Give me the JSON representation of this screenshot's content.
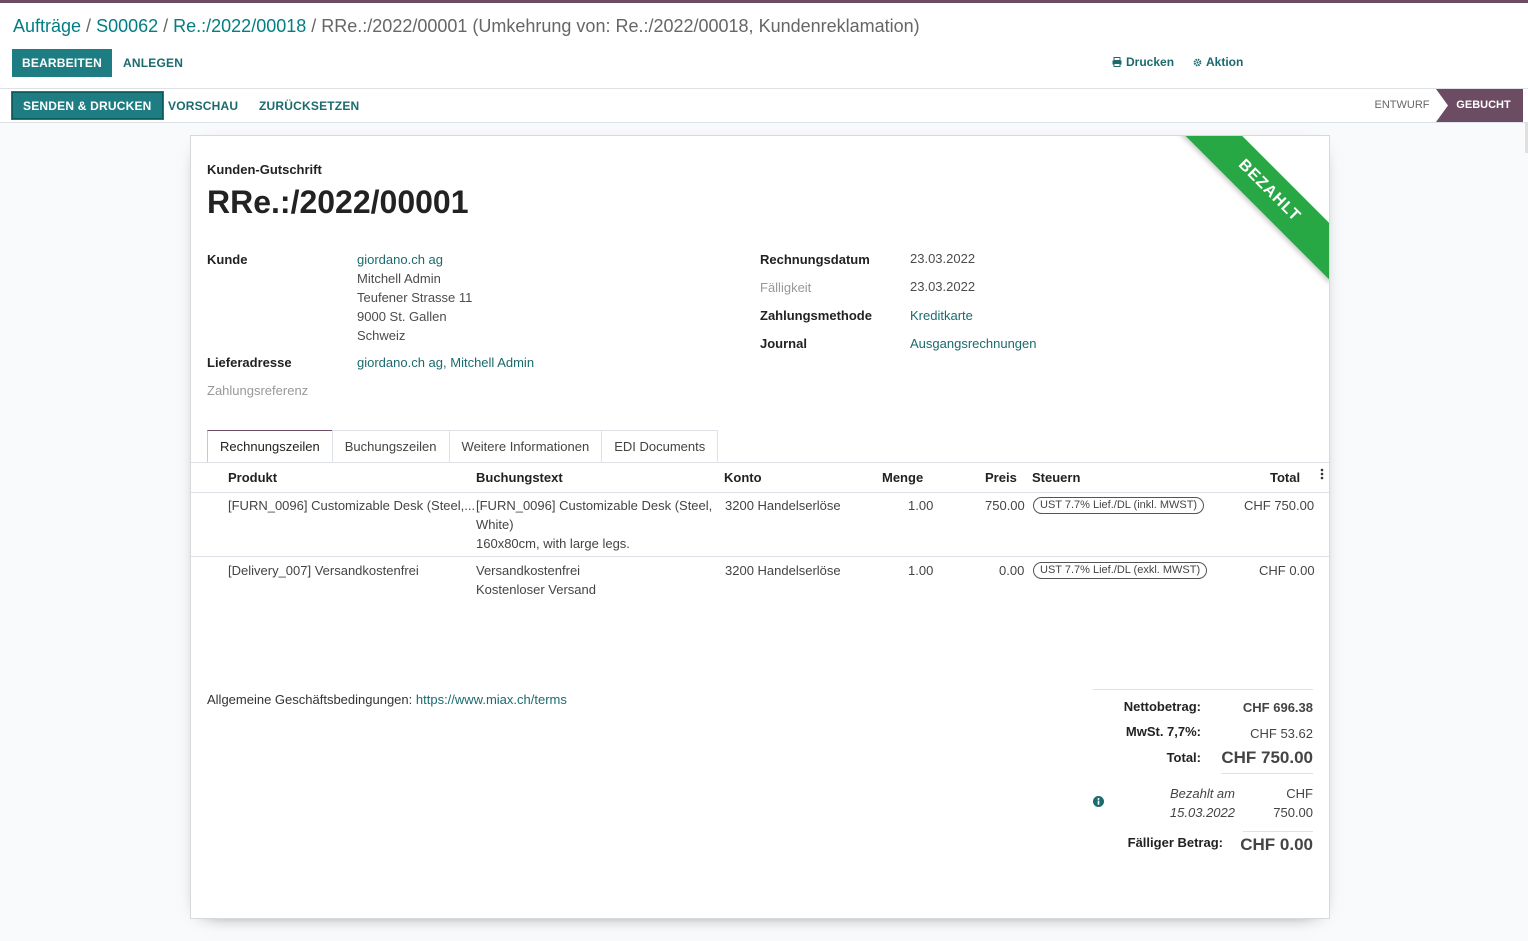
{
  "breadcrumb": {
    "items": [
      "Aufträge",
      "S00062",
      "Re.:/2022/00018"
    ],
    "current": "RRe.:/2022/00001 (Umkehrung von: Re.:/2022/00018, Kundenreklamation)"
  },
  "toolbar": {
    "edit_label": "BEARBEITEN",
    "create_label": "ANLEGEN",
    "print_label": "Drucken",
    "action_label": "Aktion"
  },
  "statusbar": {
    "send_print_label": "SENDEN & DRUCKEN",
    "preview_label": "VORSCHAU",
    "reset_label": "ZURÜCKSETZEN",
    "stages": [
      "ENTWURF",
      "GEBUCHT"
    ]
  },
  "document": {
    "ribbon": "BEZAHLT",
    "type": "Kunden-Gutschrift",
    "name": "RRe.:/2022/00001",
    "labels": {
      "customer": "Kunde",
      "delivery": "Lieferadresse",
      "payment_ref": "Zahlungsreferenz",
      "invoice_date": "Rechnungsdatum",
      "due": "Fälligkeit",
      "payment_method": "Zahlungsmethode",
      "journal": "Journal"
    },
    "customer": {
      "name": "giordano.ch ag",
      "contact": "Mitchell Admin",
      "street": "Teufener Strasse 11",
      "city": "9000 St. Gallen",
      "country": "Schweiz"
    },
    "delivery_address": "giordano.ch ag, Mitchell Admin",
    "invoice_date": "23.03.2022",
    "due_date": "23.03.2022",
    "payment_method": "Kreditkarte",
    "journal": "Ausgangsrechnungen"
  },
  "tabs": [
    "Rechnungszeilen",
    "Buchungszeilen",
    "Weitere Informationen",
    "EDI Documents"
  ],
  "lines": {
    "headers": [
      "Produkt",
      "Buchungstext",
      "Konto",
      "Menge",
      "Preis",
      "Steuern",
      "Total"
    ],
    "rows": [
      {
        "product": "[FURN_0096] Customizable Desk (Steel,...",
        "label1": "[FURN_0096] Customizable Desk (Steel,",
        "label2": "White)",
        "label3": "160x80cm, with large legs.",
        "account": "3200 Handelserlöse",
        "qty": "1.00",
        "price": "750.00",
        "tax": "UST 7.7% Lief./DL (inkl. MWST)",
        "total": "CHF 750.00"
      },
      {
        "product": "[Delivery_007] Versandkostenfrei",
        "label1": "Versandkostenfrei",
        "label2": "Kostenloser Versand",
        "account": "3200 Handelserlöse",
        "qty": "1.00",
        "price": "0.00",
        "tax": "UST 7.7% Lief./DL (exkl. MWST)",
        "total": "CHF 0.00"
      }
    ]
  },
  "terms": {
    "label": "Allgemeine Geschäftsbedingungen:",
    "url": "https://www.miax.ch/terms"
  },
  "totals": {
    "net_label": "Nettobetrag:",
    "net_value": "CHF 696.38",
    "vat_label": "MwSt. 7,7%:",
    "vat_value": "CHF 53.62",
    "total_label": "Total:",
    "total_value": "CHF 750.00",
    "paid_label1": "Bezahlt am",
    "paid_label2": "15.03.2022",
    "paid_value1": "CHF",
    "paid_value2": "750.00",
    "due_label": "Fälliger Betrag:",
    "due_value": "CHF 0.00"
  },
  "colors": {
    "primary": "#1d7d82",
    "accent": "#6b4c62",
    "ribbon": "#28a745"
  }
}
